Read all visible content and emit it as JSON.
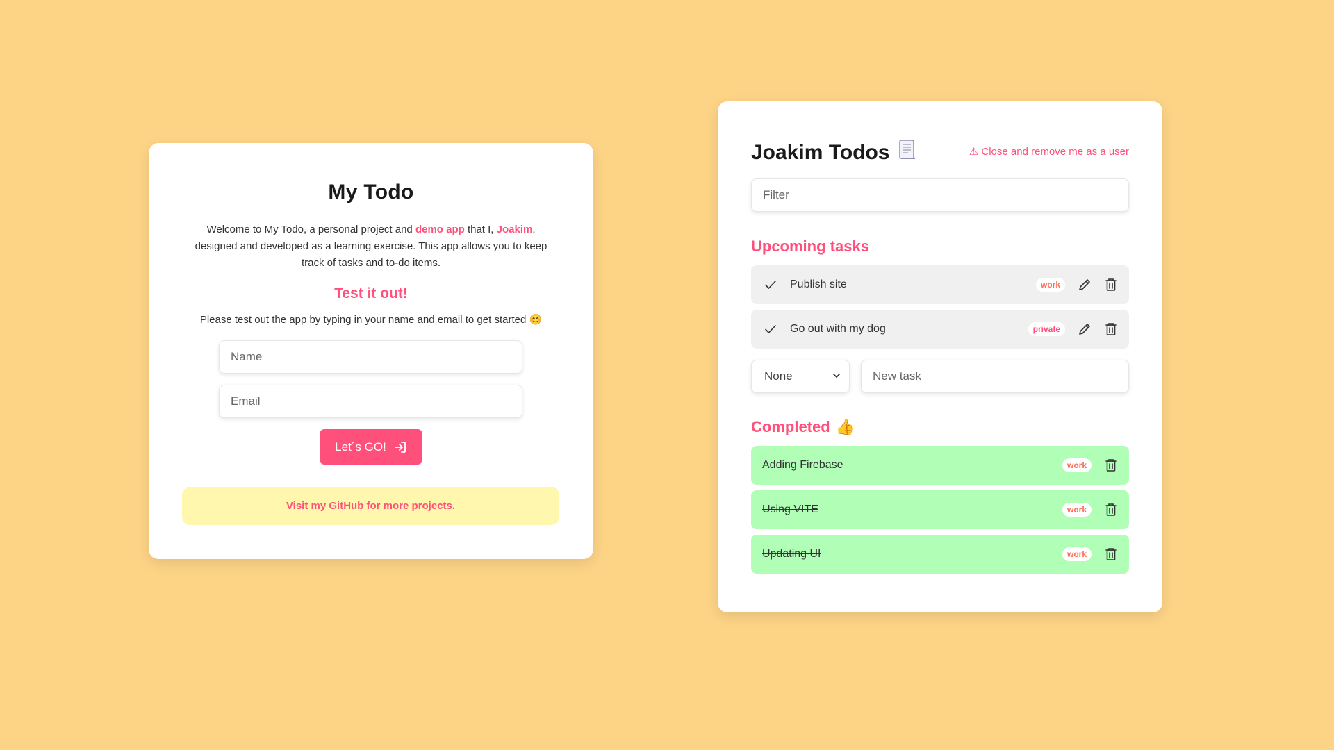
{
  "login": {
    "title": "My Todo",
    "intro_part1": "Welcome to My Todo, a personal project and ",
    "intro_link1": "demo app",
    "intro_part2": " that I, ",
    "intro_link2": "Joakim",
    "intro_part3": ", designed and developed as a learning exercise. This app allows you to keep track of tasks and to-do items.",
    "test_heading": "Test it out!",
    "test_text": "Please test out the app by typing in your name and email to get started 😊",
    "name_placeholder": "Name",
    "email_placeholder": "Email",
    "go_label": "Let´s GO!",
    "github_text": "Visit my GitHub for more projects."
  },
  "todo": {
    "title": "Joakim Todos",
    "title_icon": "document-icon",
    "remove_label": "⚠ Close and remove me as a user",
    "filter_placeholder": "Filter",
    "upcoming_heading": "Upcoming tasks",
    "upcoming": [
      {
        "text": "Publish site",
        "tag": "work"
      },
      {
        "text": "Go out with my dog",
        "tag": "private"
      }
    ],
    "category_select": "None",
    "new_task_placeholder": "New task",
    "completed_heading": "Completed",
    "completed_emoji": "👍",
    "completed": [
      {
        "text": "Adding Firebase",
        "tag": "work"
      },
      {
        "text": "Using VITE",
        "tag": "work"
      },
      {
        "text": "Updating UI",
        "tag": "work"
      }
    ]
  },
  "colors": {
    "background": "#fdd386",
    "accent": "#ff4f7b",
    "completed_row": "#b1feb7",
    "upcoming_row": "#f0f0f0",
    "github_box": "#fff7ad"
  }
}
